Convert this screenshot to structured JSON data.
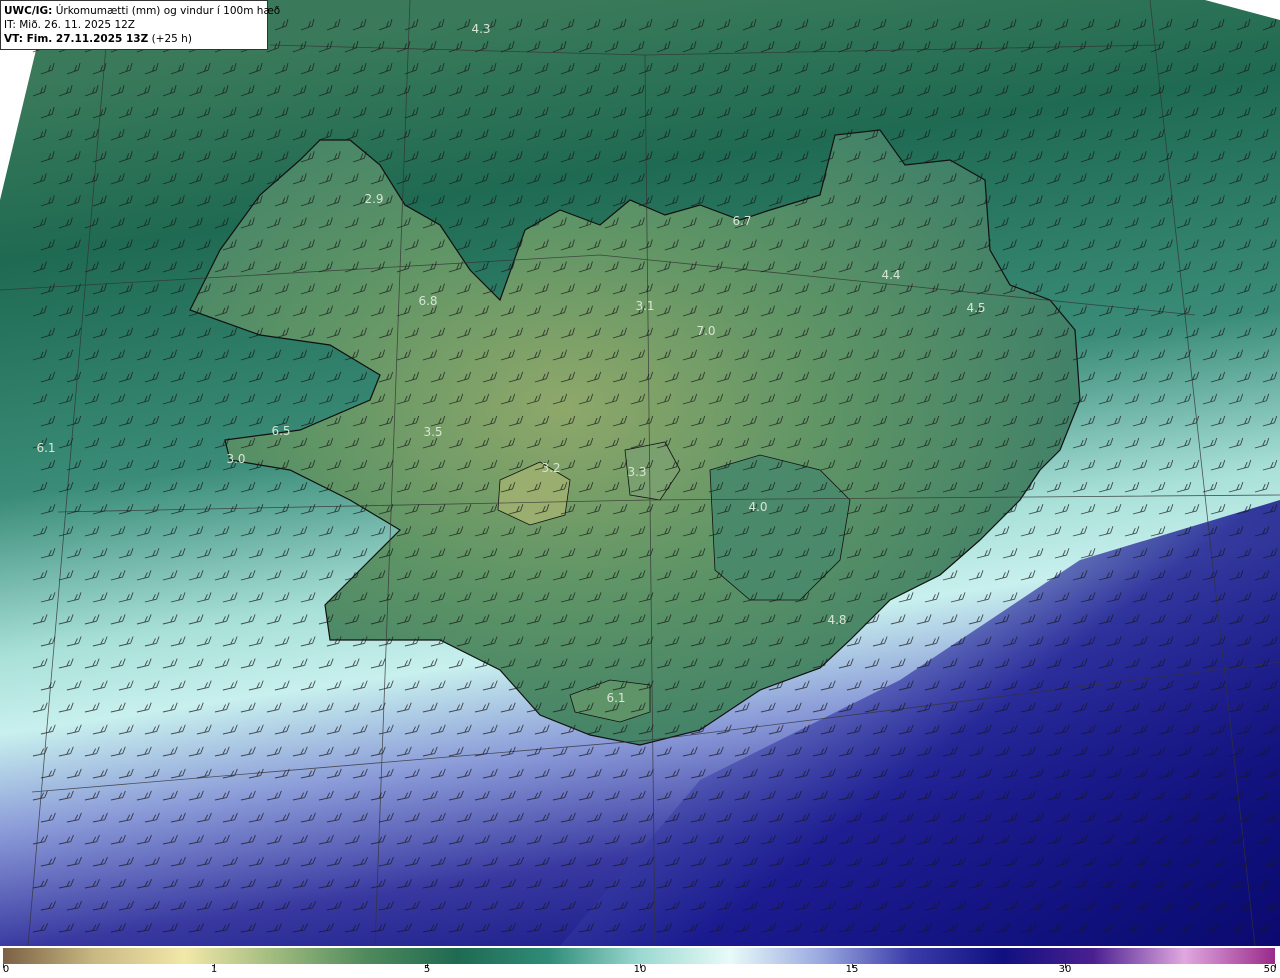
{
  "header": {
    "line1_bold": "UWC/IG:",
    "line1_rest": " Úrkomumætti (mm) og vindur í 100m hæð",
    "line2": "IT: Mið. 26. 11. 2025 12Z",
    "line3_bold": "VT: Fim. 27.11.2025 13Z",
    "line3_rest": " (+25 h)"
  },
  "map_values": [
    "4.3",
    "2.9",
    "6.7",
    "4.4",
    "4.5",
    "6.8",
    "3.1",
    "7.0",
    "6.1",
    "6.5",
    "3.0",
    "3.5",
    "3.2",
    "3.3",
    "4.0",
    "4.8",
    "6.1"
  ],
  "legend": {
    "ticks": [
      "0",
      "1",
      "5",
      "10",
      "15",
      "30",
      "50"
    ],
    "colors": [
      "#7a6144",
      "#c8b882",
      "#f2e8a8",
      "#9fba7e",
      "#4f8a5c",
      "#1f6a52",
      "#2f8c78",
      "#9ad8d0",
      "#e8fbf8",
      "#9aa8e0",
      "#3a3aa8",
      "#101080",
      "#4a2090",
      "#e0a8e0",
      "#9a2a8a"
    ]
  },
  "colors": {
    "sea_north": "#2e6a4f",
    "sea_south": "#0c0c7a",
    "land": "#4f8a5c",
    "land_high": "#8fa86a",
    "coastline": "#111111",
    "wind_barb": "#1a1a1a"
  }
}
